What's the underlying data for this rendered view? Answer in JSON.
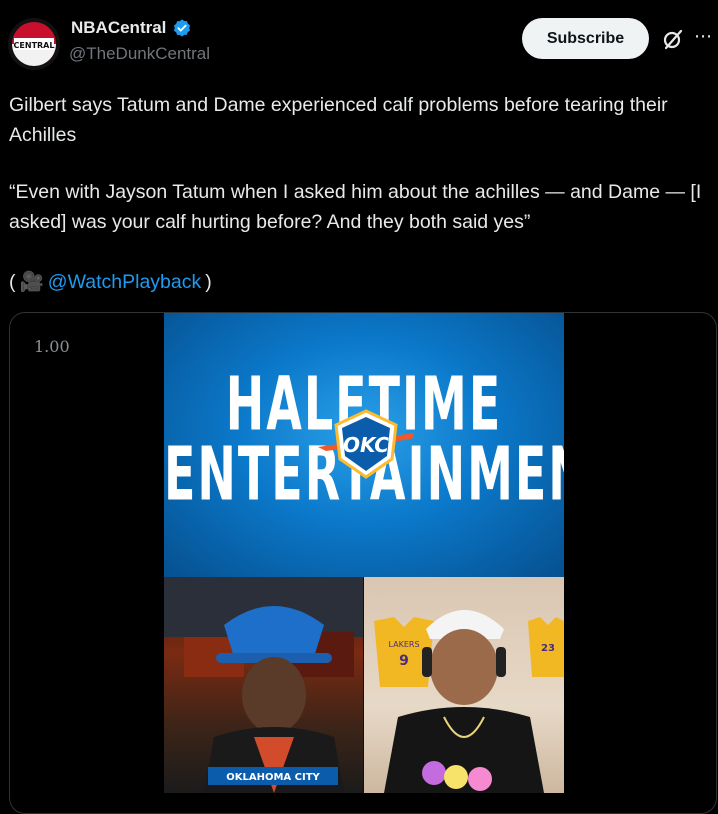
{
  "header": {
    "display_name": "NBACentral",
    "handle": "@TheDunkCentral",
    "subscribe_label": "Subscribe",
    "avatar_text": "CENTRAL",
    "more_icon": "more-horizontal-icon",
    "grok_icon": "grok-icon"
  },
  "tweet": {
    "line1": "Gilbert says Tatum and Dame experienced calf problems before tearing their Achilles",
    "line2": "“Even with Jayson Tatum when I asked him about the achilles — and Dame — [I asked] was your calf hurting before? And they both said yes”",
    "credit_open": "(",
    "credit_emoji": "🎥",
    "credit_link": "@WatchPlayback",
    "credit_close": ")"
  },
  "media": {
    "speed_label": "1.00",
    "banner_top": "HALFTIME",
    "banner_bottom": "ENTERTAINMENT",
    "logo_text": "OKC",
    "left_jersey_text": "OKLAHOMA CITY",
    "right_jersey_1_team": "LAKERS",
    "right_jersey_1_number": "9",
    "right_jersey_2_number": "23"
  },
  "colors": {
    "background": "#000000",
    "text": "#e7e9ea",
    "secondary": "#71767b",
    "link": "#1d9bf0",
    "verified": "#1d9bf0"
  }
}
